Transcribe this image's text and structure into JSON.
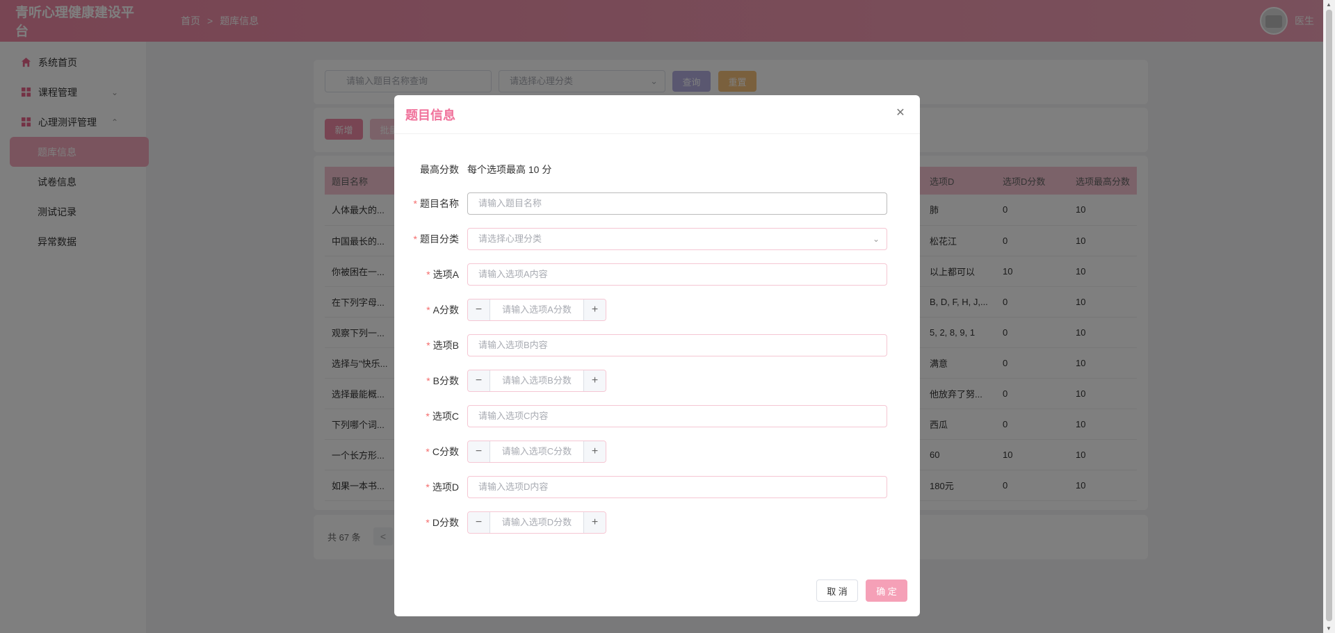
{
  "app": {
    "title": "青听心理健康建设平台"
  },
  "breadcrumb": {
    "home": "首页",
    "sep": ">",
    "current": "题库信息"
  },
  "user": {
    "name": "医生"
  },
  "sidebar": {
    "home": "系统首页",
    "course": "课程管理",
    "psych": "心理测评管理",
    "subitems": [
      "题库信息",
      "试卷信息",
      "测试记录",
      "异常数据"
    ]
  },
  "search": {
    "name_placeholder": "请输入题目名称查询",
    "category_placeholder": "请选择心理分类",
    "query_label": "查询",
    "reset_label": "重置"
  },
  "actions": {
    "add_label": "新增",
    "batch_label": "批量"
  },
  "table": {
    "headers": {
      "name": "题目名称",
      "optD": "选项D",
      "scoreD": "选项D分数",
      "max": "选项最高分数"
    },
    "rows": [
      {
        "name": "人体最大的...",
        "optD": "肺",
        "scoreD": "0",
        "max": "10"
      },
      {
        "name": "中国最长的...",
        "optD": "松花江",
        "scoreD": "0",
        "max": "10"
      },
      {
        "name": "你被困在一...",
        "optD": "以上都可以",
        "scoreD": "10",
        "max": "10"
      },
      {
        "name": "在下列字母...",
        "optD": "B, D, F, H, J,...",
        "scoreD": "0",
        "max": "10"
      },
      {
        "name": "观察下列一...",
        "optD": "5, 2, 8, 9, 1",
        "scoreD": "0",
        "max": "10"
      },
      {
        "name": "选择与\"快乐...",
        "optD": "满意",
        "scoreD": "0",
        "max": "10"
      },
      {
        "name": "选择最能概...",
        "optD": "他放弃了努...",
        "scoreD": "0",
        "max": "10"
      },
      {
        "name": "下列哪个词...",
        "optD": "西瓜",
        "scoreD": "0",
        "max": "10"
      },
      {
        "name": "一个长方形...",
        "optD": "60",
        "scoreD": "10",
        "max": "10"
      },
      {
        "name": "如果一本书...",
        "optD": "180元",
        "scoreD": "0",
        "max": "10"
      }
    ]
  },
  "pagination": {
    "total": "共 67 条",
    "prev": "<"
  },
  "dialog": {
    "title": "题目信息",
    "max_score_label": "最高分数",
    "max_score_text": "每个选项最高 10 分",
    "name_label": "题目名称",
    "name_placeholder": "请输入题目名称",
    "category_label": "题目分类",
    "category_placeholder": "请选择心理分类",
    "optA_label": "选项A",
    "optA_placeholder": "请输入选项A内容",
    "scoreA_label": "A分数",
    "scoreA_placeholder": "请输入选项A分数",
    "optB_label": "选项B",
    "optB_placeholder": "请输入选项B内容",
    "scoreB_label": "B分数",
    "scoreB_placeholder": "请输入选项B分数",
    "optC_label": "选项C",
    "optC_placeholder": "请输入选项C内容",
    "scoreC_label": "C分数",
    "scoreC_placeholder": "请输入选项C分数",
    "optD_label": "选项D",
    "optD_placeholder": "请输入选项D内容",
    "scoreD_label": "D分数",
    "scoreD_placeholder": "请输入选项D分数",
    "required_mark": "*",
    "minus": "−",
    "plus": "+",
    "cancel_label": "取 消",
    "ok_label": "确 定"
  },
  "colors": {
    "brand": "#f08aa6",
    "accent": "#f0719a",
    "overlay": "rgba(0,0,0,0.5)"
  }
}
